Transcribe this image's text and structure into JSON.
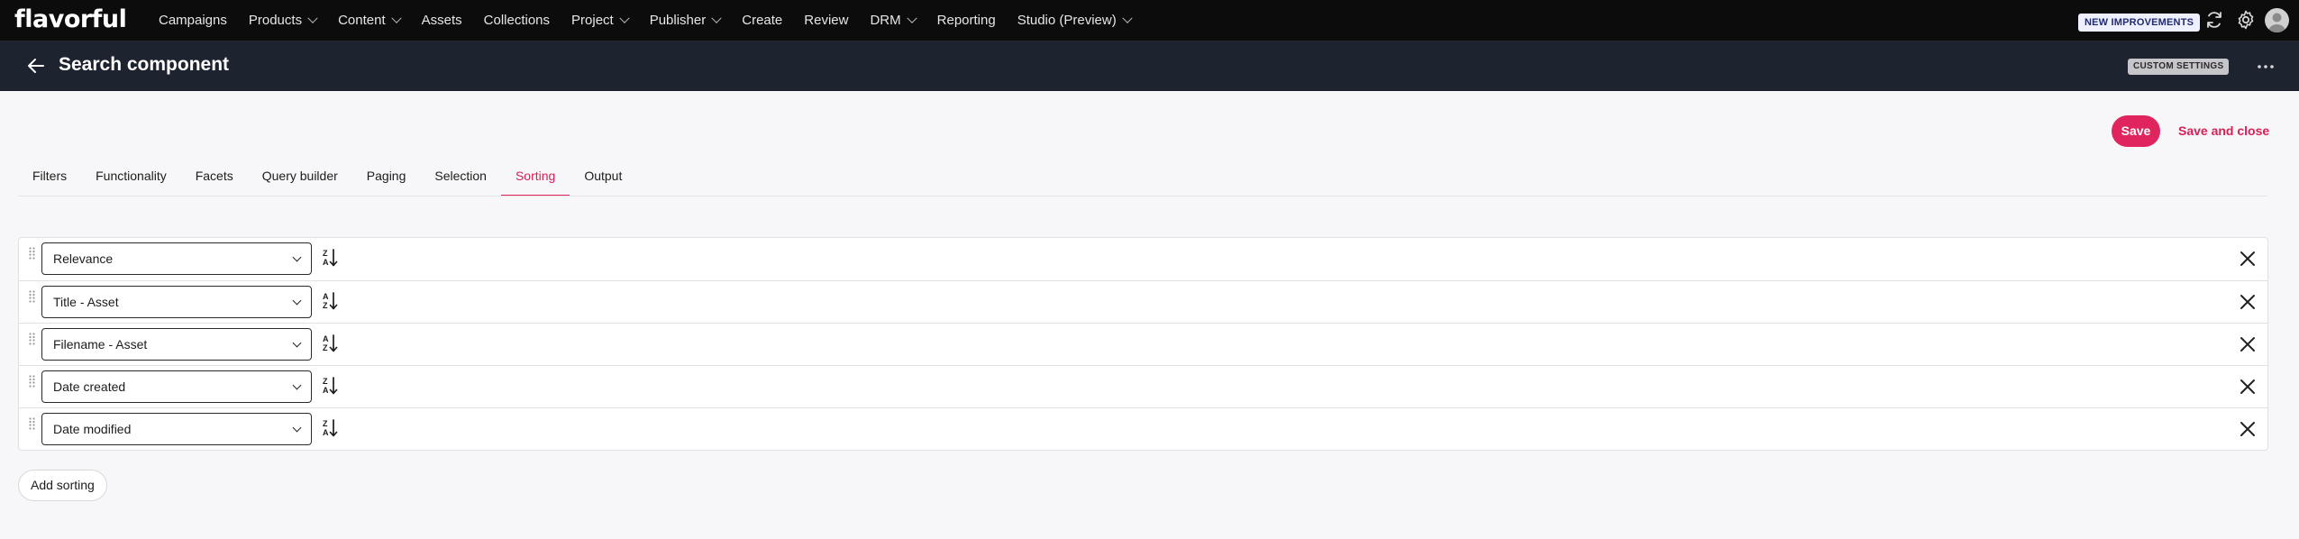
{
  "app": {
    "logo": "flavorful"
  },
  "nav": {
    "items": [
      {
        "label": "Campaigns",
        "dropdown": false
      },
      {
        "label": "Products",
        "dropdown": true
      },
      {
        "label": "Content",
        "dropdown": true
      },
      {
        "label": "Assets",
        "dropdown": false
      },
      {
        "label": "Collections",
        "dropdown": false
      },
      {
        "label": "Project",
        "dropdown": true
      },
      {
        "label": "Publisher",
        "dropdown": true
      },
      {
        "label": "Create",
        "dropdown": false
      },
      {
        "label": "Review",
        "dropdown": false
      },
      {
        "label": "DRM",
        "dropdown": true
      },
      {
        "label": "Reporting",
        "dropdown": false
      },
      {
        "label": "Studio (Preview)",
        "dropdown": true
      }
    ],
    "new_improvements": "NEW IMPROVEMENTS",
    "icons": [
      "sync-icon",
      "gear-icon",
      "avatar"
    ]
  },
  "header": {
    "title": "Search component",
    "badge": "CUSTOM SETTINGS",
    "back_icon": "arrow-left-icon",
    "more_icon": "more-dots-icon"
  },
  "actions": {
    "save": "Save",
    "save_close": "Save and close"
  },
  "tabs": [
    {
      "label": "Filters",
      "active": false
    },
    {
      "label": "Functionality",
      "active": false
    },
    {
      "label": "Facets",
      "active": false
    },
    {
      "label": "Query builder",
      "active": false
    },
    {
      "label": "Paging",
      "active": false
    },
    {
      "label": "Selection",
      "active": false
    },
    {
      "label": "Sorting",
      "active": true
    },
    {
      "label": "Output",
      "active": false
    }
  ],
  "sorting": {
    "rows": [
      {
        "field": "Relevance",
        "direction": "descending"
      },
      {
        "field": "Title - Asset",
        "direction": "ascending"
      },
      {
        "field": "Filename - Asset",
        "direction": "ascending"
      },
      {
        "field": "Date created",
        "direction": "descending"
      },
      {
        "field": "Date modified",
        "direction": "descending"
      }
    ],
    "add_label": "Add sorting"
  },
  "colors": {
    "accent": "#e0245e",
    "topnav": "#0c0c0c",
    "header": "#1e2330"
  }
}
